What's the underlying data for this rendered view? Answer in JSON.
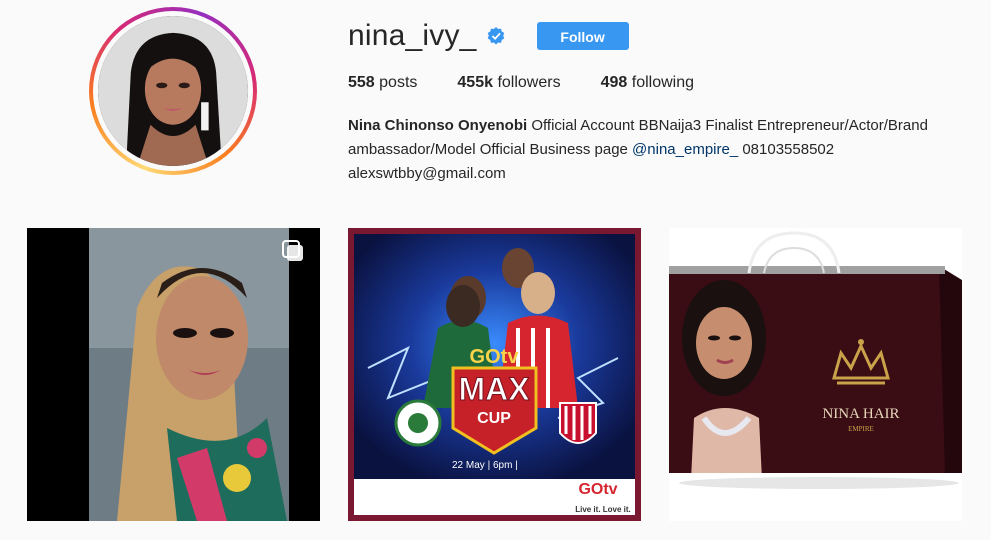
{
  "profile": {
    "username": "nina_ivy_",
    "follow_label": "Follow",
    "stats": {
      "posts_count": "558",
      "posts_label": "posts",
      "followers_count": "455k",
      "followers_label": "followers",
      "following_count": "498",
      "following_label": "following"
    },
    "bio": {
      "full_name": "Nina Chinonso Onyenobi",
      "text_part1": " Official Account BBNaija3 Finalist Entrepreneur/Actor/Brand ambassador/Model Official Business page ",
      "mention": "@nina_empire_",
      "text_part2": " 08103558502",
      "email": "alexswtbby@gmail.com"
    }
  },
  "posts": [
    {
      "icon": "multiple-photos-icon"
    },
    {
      "brand": "GOtv",
      "title": "MAX",
      "subtitle": "CUP",
      "date_line": "22 May | 6pm | ",
      "footer_brand": "GOtv",
      "footer_tagline": "Live it. Love it."
    },
    {
      "brand_name": "NINA HAIR",
      "brand_sub": "EMPIRE"
    }
  ],
  "colors": {
    "follow_bg": "#3897f0",
    "verified_blue": "#3897f0",
    "background": "#fafafa"
  }
}
